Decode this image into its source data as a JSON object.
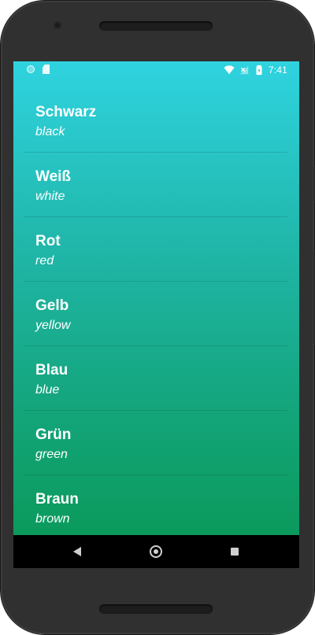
{
  "status_bar": {
    "time": "7:41",
    "icons": [
      "circle-indicator-icon",
      "sd-card-icon",
      "wifi-icon",
      "no-signal-icon",
      "battery-icon"
    ]
  },
  "colors": {
    "gradient_top": "#2fd3e0",
    "gradient_bottom": "#0b9a5c",
    "text": "#ffffff",
    "nav_bar": "#000000",
    "device": "#303030"
  },
  "colors_list": {
    "items": [
      {
        "german": "Schwarz",
        "english": "black"
      },
      {
        "german": "Weiß",
        "english": "white"
      },
      {
        "german": "Rot",
        "english": "red"
      },
      {
        "german": "Gelb",
        "english": "yellow"
      },
      {
        "german": "Blau",
        "english": "blue"
      },
      {
        "german": "Grün",
        "english": "green"
      },
      {
        "german": "Braun",
        "english": "brown"
      }
    ]
  },
  "nav_bar": {
    "icons": [
      "back-icon",
      "home-icon",
      "recent-apps-icon"
    ]
  }
}
